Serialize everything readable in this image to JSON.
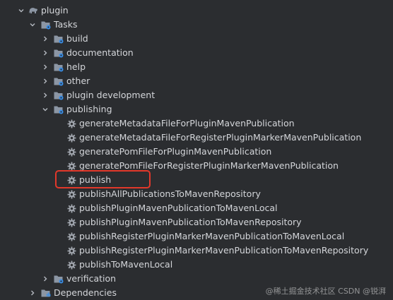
{
  "tree": {
    "root": {
      "label": "plugin",
      "icon": "elephant-icon"
    },
    "tasks": {
      "label": "Tasks",
      "icon": "folder-gear-icon"
    },
    "groups_before": [
      {
        "label": "build"
      },
      {
        "label": "documentation"
      },
      {
        "label": "help"
      },
      {
        "label": "other"
      },
      {
        "label": "plugin development"
      }
    ],
    "publishing": {
      "label": "publishing",
      "tasks": [
        "generateMetadataFileForPluginMavenPublication",
        "generateMetadataFileForRegisterPluginMarkerMavenPublication",
        "generatePomFileForPluginMavenPublication",
        "generatePomFileForRegisterPluginMarkerMavenPublication",
        "publish",
        "publishAllPublicationsToMavenRepository",
        "publishPluginMavenPublicationToMavenLocal",
        "publishPluginMavenPublicationToMavenRepository",
        "publishRegisterPluginMarkerMavenPublicationToMavenLocal",
        "publishRegisterPluginMarkerMavenPublicationToMavenRepository",
        "publishToMavenLocal"
      ]
    },
    "verification": {
      "label": "verification"
    },
    "dependencies": {
      "label": "Dependencies",
      "icon": "dependencies-icon"
    }
  },
  "highlighted_task": "publish",
  "colors": {
    "background": "#2b2d30",
    "text": "#d4d6da",
    "highlight": "#e2382a",
    "folder": "#8c96a4",
    "gear": "#9ea3ab"
  },
  "watermark": "@稀土掘金技术社区 CSDN @锐湃"
}
